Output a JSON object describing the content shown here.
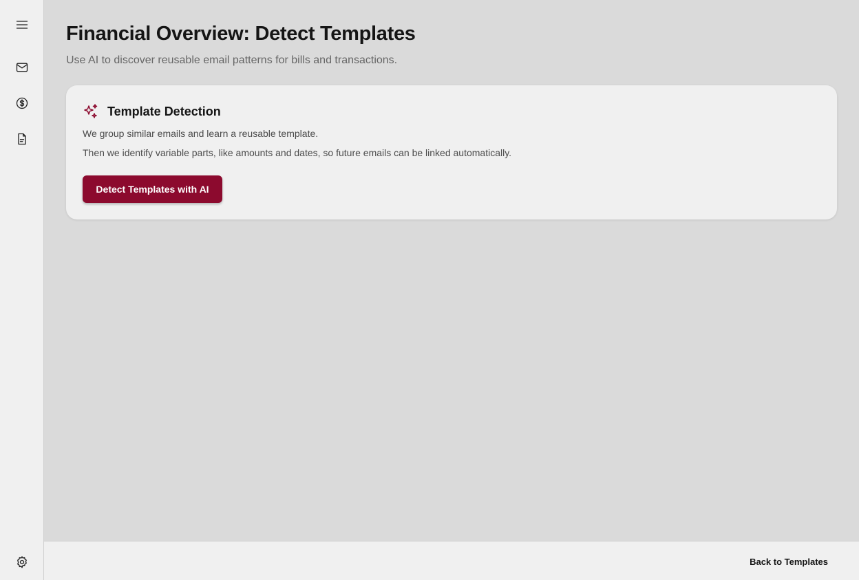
{
  "sidebar": {
    "items": [
      {
        "icon": "menu-icon"
      },
      {
        "icon": "mail-icon"
      },
      {
        "icon": "dollar-circle-icon"
      },
      {
        "icon": "document-icon"
      },
      {
        "icon": "gear-icon"
      }
    ]
  },
  "header": {
    "title": "Financial Overview: Detect Templates",
    "subtitle": "Use AI to discover reusable email patterns for bills and transactions."
  },
  "card": {
    "icon": "sparkles-icon",
    "title": "Template Detection",
    "line1": "We group similar emails and learn a reusable template.",
    "line2": "Then we identify variable parts, like amounts and dates, so future emails can be linked automatically.",
    "button_label": "Detect Templates with AI"
  },
  "footer": {
    "back_label": "Back to Templates"
  },
  "colors": {
    "accent": "#8c0a2e",
    "background": "#dadada",
    "surface": "#f0f0f0"
  }
}
